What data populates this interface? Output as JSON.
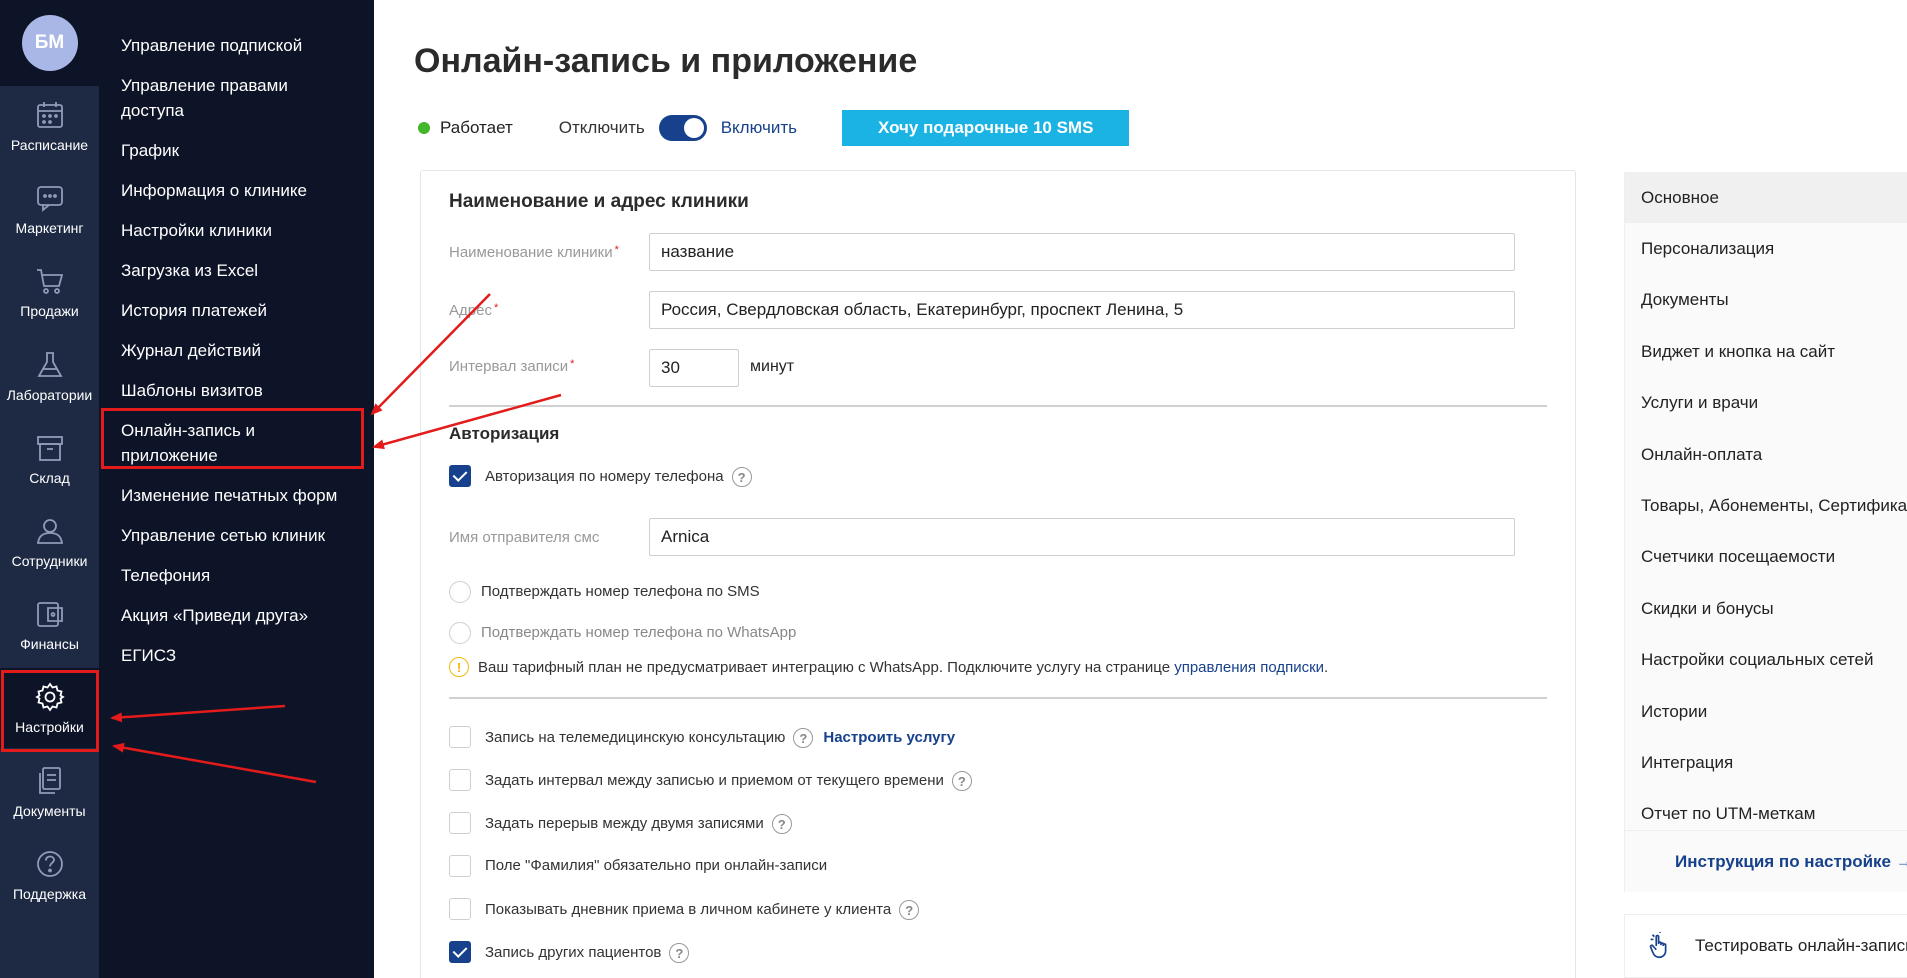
{
  "user": {
    "initials": "БМ"
  },
  "rail": [
    {
      "label": "Расписание",
      "icon": "calendar-icon"
    },
    {
      "label": "Маркетинг",
      "icon": "chat-icon"
    },
    {
      "label": "Продажи",
      "icon": "cart-icon"
    },
    {
      "label": "Лаборатории",
      "icon": "flask-icon"
    },
    {
      "label": "Склад",
      "icon": "box-icon"
    },
    {
      "label": "Сотрудники",
      "icon": "person-icon"
    },
    {
      "label": "Финансы",
      "icon": "wallet-icon"
    },
    {
      "label": "Настройки",
      "icon": "gear-icon",
      "active": true
    },
    {
      "label": "Документы",
      "icon": "documents-icon"
    },
    {
      "label": "Поддержка",
      "icon": "help-icon"
    }
  ],
  "submenu": [
    "Управление подпиской",
    "Управление правами доступа",
    "График",
    "Информация о клинике",
    "Настройки клиники",
    "Загрузка из Excel",
    "История платежей",
    "Журнал действий",
    "Шаблоны визитов",
    "Онлайн-запись и приложение",
    "Изменение печатных форм",
    "Управление сетью клиник",
    "Телефония",
    "Акция «Приведи друга»",
    "ЕГИСЗ"
  ],
  "header": {
    "title": "Онлайн-запись и приложение",
    "status": "Работает",
    "off_label": "Отключить",
    "on_label": "Включить",
    "toggle_on": true,
    "gift_button": "Хочу подарочные 10 SMS"
  },
  "clinic": {
    "section_title": "Наименование и адрес клиники",
    "name_label": "Наименование клиники",
    "name_value": "название",
    "address_label": "Адрес",
    "address_value": "Россия, Свердловская область, Екатеринбург, проспект Ленина, 5",
    "interval_label": "Интервал записи",
    "interval_value": "30",
    "interval_unit": "минут",
    "required_mark": "*"
  },
  "auth": {
    "section_title": "Авторизация",
    "phone_auth_label": "Авторизация по номеру телефона",
    "phone_auth_checked": true,
    "sender_label": "Имя отправителя смс",
    "sender_value": "Arnica",
    "confirm_sms": "Подтверждать номер телефона по SMS",
    "confirm_whatsapp": "Подтверждать номер телефона по WhatsApp",
    "warning_text": "Ваш тарифный план не предусматривает интеграцию с WhatsApp. Подключите услугу на странице",
    "warning_link": "управления подписки",
    "warning_end": "."
  },
  "options": [
    {
      "label": "Запись на телемедицинскую консультацию",
      "checked": false,
      "help": true,
      "link": "Настроить услугу"
    },
    {
      "label": "Задать интервал между записью и приемом от текущего времени",
      "checked": false,
      "help": true
    },
    {
      "label": "Задать перерыв между двумя записями",
      "checked": false,
      "help": true
    },
    {
      "label": "Поле \"Фамилия\" обязательно при онлайн-записи",
      "checked": false,
      "help": false
    },
    {
      "label": "Показывать дневник приема в личном кабинете у клиента",
      "checked": false,
      "help": true
    },
    {
      "label": "Запись других пациентов",
      "checked": true,
      "help": true
    }
  ],
  "help_glyph": "?",
  "warn_glyph": "!",
  "right_nav": {
    "items": [
      "Основное",
      "Персонализация",
      "Документы",
      "Виджет и кнопка на сайт",
      "Услуги и врачи",
      "Онлайн-оплата",
      "Товары, Абонементы, Сертификаты",
      "Счетчики посещаемости",
      "Скидки и бонусы",
      "Настройки социальных сетей",
      "Истории",
      "Интеграция",
      "Отчет по UTM-меткам"
    ],
    "active_index": 0,
    "instruction": "Инструкция по настройке →",
    "test_button": "Тестировать онлайн-запись"
  },
  "colors": {
    "sidebar_dark": "#0d1427",
    "rail": "#1e2a44",
    "accent_blue": "#17418c",
    "gift_button": "#1ab3e3",
    "status_green": "#42b72a",
    "annotation_red": "#e31b1b"
  }
}
